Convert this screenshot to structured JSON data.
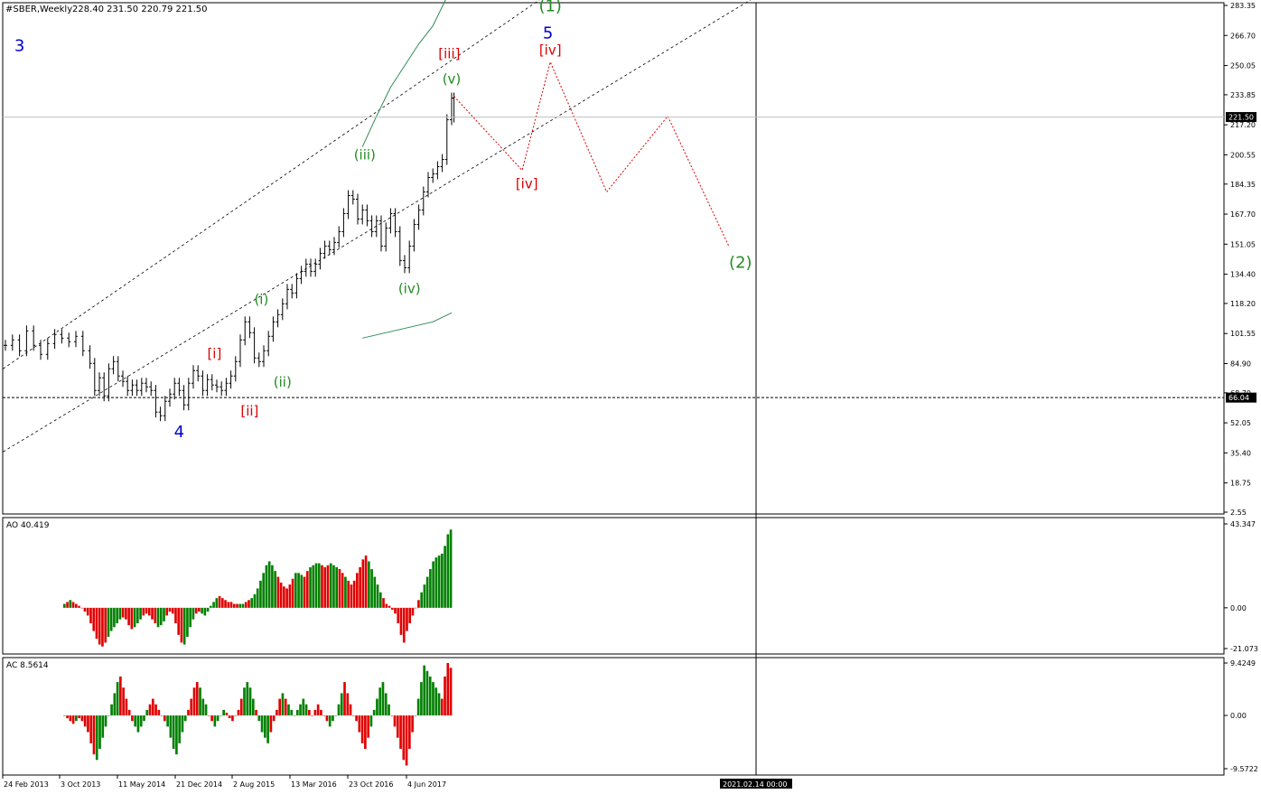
{
  "chart_data": {
    "type": "candlestick-with-oscillators",
    "symbol_header": "#SBER,Weekly",
    "ohlc_header": "228.40 231.50 220.79 221.50",
    "price_axis_ticks": [
      "283.35",
      "266.70",
      "250.05",
      "233.85",
      "217.20",
      "200.55",
      "184.35",
      "167.70",
      "151.05",
      "134.40",
      "118.20",
      "101.55",
      "84.90",
      "68.70",
      "52.05",
      "35.40",
      "18.75",
      "2.55"
    ],
    "price_range": [
      2.55,
      283.35
    ],
    "current_price_tag": "221.50",
    "hline_price_tag": "66.04",
    "hline_price": 66.04,
    "price_series": [
      {
        "t": 0,
        "p": 95
      },
      {
        "t": 3,
        "p": 98
      },
      {
        "t": 6,
        "p": 92
      },
      {
        "t": 9,
        "p": 103
      },
      {
        "t": 12,
        "p": 95
      },
      {
        "t": 15,
        "p": 90
      },
      {
        "t": 18,
        "p": 96
      },
      {
        "t": 21,
        "p": 101
      },
      {
        "t": 24,
        "p": 99
      },
      {
        "t": 27,
        "p": 97
      },
      {
        "t": 30,
        "p": 100
      },
      {
        "t": 33,
        "p": 92
      },
      {
        "t": 36,
        "p": 85
      },
      {
        "t": 38,
        "p": 70
      },
      {
        "t": 40,
        "p": 77
      },
      {
        "t": 42,
        "p": 67
      },
      {
        "t": 44,
        "p": 82
      },
      {
        "t": 46,
        "p": 86
      },
      {
        "t": 48,
        "p": 78
      },
      {
        "t": 50,
        "p": 75
      },
      {
        "t": 52,
        "p": 70
      },
      {
        "t": 54,
        "p": 73
      },
      {
        "t": 56,
        "p": 70
      },
      {
        "t": 58,
        "p": 74
      },
      {
        "t": 60,
        "p": 72
      },
      {
        "t": 62,
        "p": 70
      },
      {
        "t": 64,
        "p": 58
      },
      {
        "t": 66,
        "p": 56
      },
      {
        "t": 68,
        "p": 64
      },
      {
        "t": 70,
        "p": 68
      },
      {
        "t": 72,
        "p": 74
      },
      {
        "t": 74,
        "p": 70
      },
      {
        "t": 76,
        "p": 62
      },
      {
        "t": 78,
        "p": 74
      },
      {
        "t": 80,
        "p": 81
      },
      {
        "t": 82,
        "p": 78
      },
      {
        "t": 84,
        "p": 70
      },
      {
        "t": 86,
        "p": 76
      },
      {
        "t": 88,
        "p": 73
      },
      {
        "t": 90,
        "p": 72
      },
      {
        "t": 92,
        "p": 70
      },
      {
        "t": 94,
        "p": 74
      },
      {
        "t": 96,
        "p": 78
      },
      {
        "t": 98,
        "p": 86
      },
      {
        "t": 100,
        "p": 98
      },
      {
        "t": 102,
        "p": 108
      },
      {
        "t": 104,
        "p": 102
      },
      {
        "t": 106,
        "p": 88
      },
      {
        "t": 108,
        "p": 86
      },
      {
        "t": 110,
        "p": 92
      },
      {
        "t": 112,
        "p": 100
      },
      {
        "t": 114,
        "p": 108
      },
      {
        "t": 116,
        "p": 112
      },
      {
        "t": 118,
        "p": 118
      },
      {
        "t": 120,
        "p": 126
      },
      {
        "t": 122,
        "p": 124
      },
      {
        "t": 124,
        "p": 132
      },
      {
        "t": 126,
        "p": 136
      },
      {
        "t": 128,
        "p": 140
      },
      {
        "t": 130,
        "p": 136
      },
      {
        "t": 132,
        "p": 140
      },
      {
        "t": 134,
        "p": 146
      },
      {
        "t": 136,
        "p": 150
      },
      {
        "t": 138,
        "p": 148
      },
      {
        "t": 140,
        "p": 152
      },
      {
        "t": 142,
        "p": 158
      },
      {
        "t": 144,
        "p": 168
      },
      {
        "t": 146,
        "p": 178
      },
      {
        "t": 148,
        "p": 176
      },
      {
        "t": 150,
        "p": 165
      },
      {
        "t": 152,
        "p": 170
      },
      {
        "t": 154,
        "p": 164
      },
      {
        "t": 156,
        "p": 158
      },
      {
        "t": 158,
        "p": 164
      },
      {
        "t": 160,
        "p": 150
      },
      {
        "t": 162,
        "p": 160
      },
      {
        "t": 164,
        "p": 168
      },
      {
        "t": 166,
        "p": 158
      },
      {
        "t": 168,
        "p": 142
      },
      {
        "t": 170,
        "p": 138
      },
      {
        "t": 172,
        "p": 150
      },
      {
        "t": 174,
        "p": 162
      },
      {
        "t": 176,
        "p": 170
      },
      {
        "t": 178,
        "p": 180
      },
      {
        "t": 180,
        "p": 188
      },
      {
        "t": 182,
        "p": 190
      },
      {
        "t": 184,
        "p": 194
      },
      {
        "t": 186,
        "p": 198
      },
      {
        "t": 188,
        "p": 220
      },
      {
        "t": 190,
        "p": 232
      },
      {
        "t": 191,
        "p": 221.5
      }
    ],
    "envelope_upper": [
      {
        "t": 152,
        "p": 205
      },
      {
        "t": 158,
        "p": 222
      },
      {
        "t": 164,
        "p": 238
      },
      {
        "t": 170,
        "p": 250
      },
      {
        "t": 176,
        "p": 262
      },
      {
        "t": 182,
        "p": 272
      },
      {
        "t": 188,
        "p": 288
      }
    ],
    "envelope_lower": [
      {
        "t": 152,
        "p": 99
      },
      {
        "t": 162,
        "p": 102
      },
      {
        "t": 172,
        "p": 105
      },
      {
        "t": 182,
        "p": 108
      },
      {
        "t": 190,
        "p": 113
      }
    ],
    "forecast_path": [
      {
        "t": 191,
        "p": 233
      },
      {
        "t": 220,
        "p": 192
      },
      {
        "t": 232,
        "p": 252
      },
      {
        "t": 256,
        "p": 180
      },
      {
        "t": 282,
        "p": 222
      },
      {
        "t": 308,
        "p": 150
      }
    ],
    "wave_labels": [
      {
        "text": "3",
        "color": "#0000cc",
        "t": 6,
        "p": 258,
        "size": 18
      },
      {
        "text": "4",
        "color": "#0000cc",
        "t": 74,
        "p": 44,
        "size": 18
      },
      {
        "text": "5",
        "color": "#0000cc",
        "t": 231,
        "p": 265,
        "size": 18
      },
      {
        "text": "[i]",
        "color": "#dd0000",
        "t": 89,
        "p": 88,
        "size": 15
      },
      {
        "text": "[ii]",
        "color": "#dd0000",
        "t": 104,
        "p": 56,
        "size": 15
      },
      {
        "text": "[iii]",
        "color": "#dd0000",
        "t": 189,
        "p": 254,
        "size": 15
      },
      {
        "text": "[iv]",
        "color": "#dd0000",
        "t": 222,
        "p": 182,
        "size": 15
      },
      {
        "text": "[iv]",
        "color": "#dd0000",
        "t": 232,
        "p": 256,
        "size": 15
      },
      {
        "text": "(i)",
        "color": "#228b22",
        "t": 109,
        "p": 118,
        "size": 15
      },
      {
        "text": "(ii)",
        "color": "#228b22",
        "t": 118,
        "p": 72,
        "size": 15
      },
      {
        "text": "(iii)",
        "color": "#228b22",
        "t": 153,
        "p": 198,
        "size": 15
      },
      {
        "text": "(iv)",
        "color": "#228b22",
        "t": 172,
        "p": 124,
        "size": 15
      },
      {
        "text": "(v)",
        "color": "#228b22",
        "t": 190,
        "p": 240,
        "size": 15
      },
      {
        "text": "(1)",
        "color": "#228b22",
        "t": 232,
        "p": 280,
        "size": 18
      },
      {
        "text": "(2)",
        "color": "#228b22",
        "t": 313,
        "p": 138,
        "size": 18
      }
    ],
    "ao": {
      "label": "AO 40.419",
      "axis_ticks": [
        "43.347",
        "0.00",
        "-21.073"
      ],
      "range": [
        -21.073,
        43.347
      ],
      "values": [
        2,
        3,
        4,
        3,
        2,
        1,
        0,
        -2,
        -4,
        -8,
        -12,
        -16,
        -19,
        -20,
        -18,
        -15,
        -12,
        -10,
        -8,
        -6,
        -5,
        -6,
        -9,
        -11,
        -10,
        -8,
        -6,
        -4,
        -3,
        -4,
        -6,
        -8,
        -10,
        -9,
        -7,
        -4,
        -2,
        -3,
        -8,
        -14,
        -18,
        -19,
        -15,
        -10,
        -6,
        -3,
        -2,
        -3,
        -4,
        -2,
        1,
        3,
        5,
        6,
        5,
        4,
        3,
        3,
        2,
        2,
        2,
        2,
        3,
        4,
        5,
        7,
        10,
        14,
        18,
        22,
        24,
        22,
        19,
        16,
        13,
        11,
        10,
        12,
        15,
        18,
        18,
        17,
        16,
        19,
        21,
        22,
        23,
        23,
        22,
        21,
        22,
        23,
        22,
        21,
        20,
        18,
        16,
        14,
        12,
        14,
        18,
        21,
        25,
        27,
        24,
        20,
        16,
        12,
        8,
        5,
        2,
        1,
        -1,
        -3,
        -8,
        -14,
        -18,
        -12,
        -8,
        -4,
        0,
        4,
        8,
        12,
        16,
        20,
        24,
        26,
        27,
        28,
        32,
        38,
        40.419
      ],
      "colors": "grgrrrrrrrrrrrrgggggrrrrgggrrrrrgggrrrrrrggggrrggggggrrrrrrrggrrgggggggggrrrrrrgggrrggggrrrgggrrgrrrrrrrgggggrrrrrrrrrrrrrggggggggggggggg"
    },
    "ac": {
      "label": "AC 8.5614",
      "axis_ticks": [
        "9.4249",
        "0.00",
        "-9.5722"
      ],
      "range": [
        -9.5722,
        9.4249
      ],
      "values": [
        0,
        -0.5,
        -1,
        -1.5,
        -1,
        -0.5,
        -1,
        -2,
        -3,
        -5,
        -7,
        -8,
        -6,
        -4,
        -2,
        0,
        2,
        4,
        6,
        7,
        5,
        3,
        1,
        -1,
        -2,
        -3,
        -2,
        -1,
        1,
        2,
        3,
        2,
        1,
        0,
        -1,
        -2,
        -4,
        -6,
        -7,
        -5,
        -3,
        -1,
        1,
        3,
        5,
        6,
        5,
        3,
        2,
        0,
        -1,
        -2,
        -1,
        0,
        1,
        0.5,
        -0.5,
        -1,
        0,
        1,
        3,
        5,
        6,
        5,
        3,
        1,
        -1,
        -3,
        -4,
        -5,
        -3,
        -1,
        1,
        3,
        4,
        3,
        2,
        1,
        0,
        1,
        2,
        3,
        2,
        1,
        0,
        1,
        2,
        1,
        0,
        -1,
        -2,
        -1,
        0,
        2,
        4,
        6,
        4,
        2,
        0,
        -1,
        -3,
        -5,
        -6,
        -4,
        -2,
        1,
        3,
        5,
        6,
        4,
        2,
        0,
        -2,
        -4,
        -6,
        -8,
        -9,
        -6,
        -3,
        0,
        3,
        6,
        9,
        8,
        7,
        6,
        5,
        4,
        3,
        7,
        9.4249,
        8.5614
      ],
      "colors": "grrrgrrrrrrggggggggrrrrrgggggrrrrrrgggggggrrrrgggrrggggrrrrrrggggrggggrrrrgrgggggggrrrrrrrgggggrrrrrrrrrgggggggrrrrrrrrrggggggggrrrrrg"
    },
    "time_axis_labels": [
      "24 Feb 2013",
      "3 Oct 2013",
      "11 May 2014",
      "21 Dec 2014",
      "2 Aug 2015",
      "13 Mar 2016",
      "23 Oct 2016",
      "4 Jun 2017"
    ],
    "crosshair_time_tag": "2021.02.14 00:00",
    "grid": false
  }
}
